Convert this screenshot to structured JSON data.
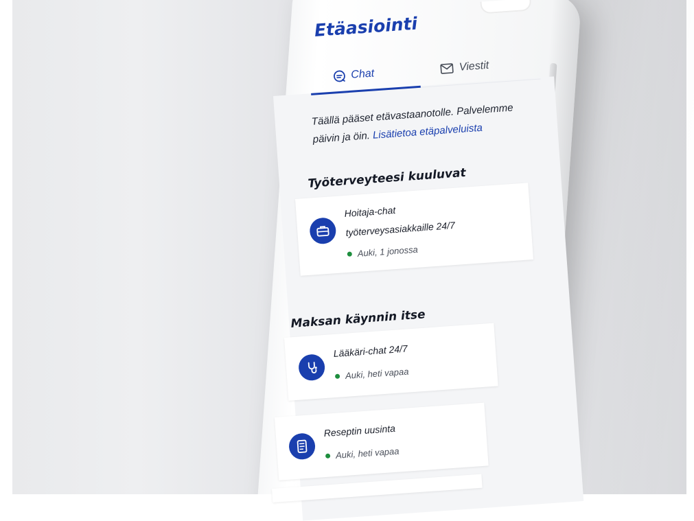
{
  "app": {
    "title": "Etäasiointi"
  },
  "tabs": [
    {
      "label": "Chat",
      "icon": "chat-bubble-icon",
      "active": true
    },
    {
      "label": "Viestit",
      "icon": "envelope-icon",
      "active": false
    }
  ],
  "intro": {
    "text": "Täällä pääset etävastaanotolle. Palvelemme päivin ja öin.",
    "link": "Lisätietoa etäpalveluista"
  },
  "sections": [
    {
      "title": "Työterveyteesi kuuluvat",
      "cards": [
        {
          "icon": "briefcase-icon",
          "line1": "Hoitaja-chat",
          "line2": "työterveysasiakkaille 24/7",
          "status": "Auki, 1 jonossa"
        }
      ]
    },
    {
      "title": "Maksan käynnin itse",
      "cards": [
        {
          "icon": "stethoscope-icon",
          "line1": "Lääkäri-chat 24/7",
          "status": "Auki, heti vapaa"
        },
        {
          "icon": "prescription-icon",
          "line1": "Reseptin uusinta",
          "status": "Auki, heti vapaa"
        }
      ]
    }
  ],
  "colors": {
    "brand": "#1a3fae",
    "status_open": "#1e8e3e",
    "content_bg": "#f4f5f7"
  }
}
